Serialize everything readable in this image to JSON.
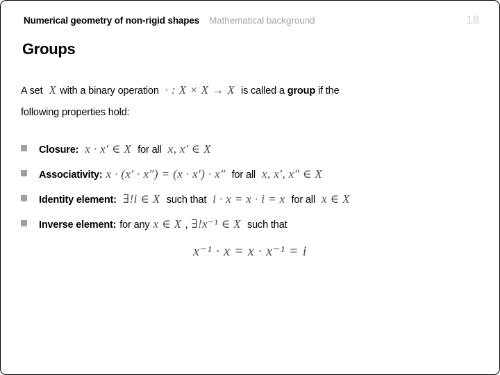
{
  "header": {
    "title": "Numerical geometry of non-rigid shapes",
    "subtitle": "Mathematical background",
    "page_number": "18"
  },
  "slide": {
    "title": "Groups",
    "intro": {
      "part1": "A set",
      "math_set": "X",
      "part2": "with a binary operation",
      "math_operation": "· : X × X → X",
      "part3": "is called a",
      "emphasis": "group",
      "part4": "if the",
      "line2": "following properties hold:"
    },
    "bullets": [
      {
        "label": "Closure:",
        "math1": "x · x′ ∈ X",
        "mid": "for all",
        "math2": "x, x′ ∈ X",
        "tail": ""
      },
      {
        "label": "Associativity:",
        "math1": "x · (x′ · x″) = (x · x′) · x″",
        "mid": "for all",
        "math2": "x, x′, x″ ∈ X",
        "tail": ""
      },
      {
        "label": "Identity element:",
        "math1": "∃!i ∈ X",
        "mid": "such that",
        "math2": "i · x = x · i = x",
        "mid2": "for all",
        "math3": "x ∈ X",
        "tail": ""
      },
      {
        "label": "Inverse element:",
        "pre": "for any",
        "math1": "x ∈ X",
        "comma": ",",
        "math2": "∃!x⁻¹ ∈ X",
        "tail": "such that"
      }
    ],
    "display_equation": "x⁻¹ · x = x · x⁻¹ = i"
  },
  "colors": {
    "bullet": "#a0a0a0",
    "subtitle": "#a6a6a6",
    "page_number": "#d4d4d4",
    "math": "#4a4a4a",
    "text": "#000000",
    "border": "#000000",
    "background": "#ffffff"
  }
}
